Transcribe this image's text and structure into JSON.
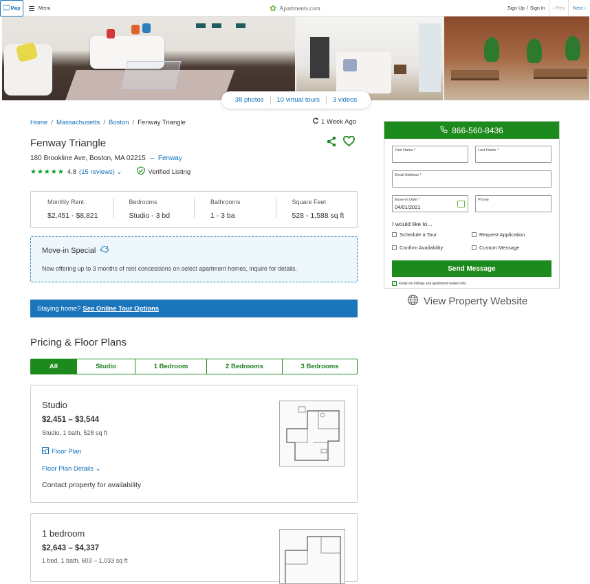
{
  "topbar": {
    "map_label": "Map",
    "menu_label": "Menu",
    "logo_text": "Apartments.com",
    "sign_up": "Sign Up",
    "slash": "/",
    "sign_in": "Sign In",
    "prev": "Prev",
    "next": "Next"
  },
  "gallery": {
    "photos": "38 photos",
    "virtual_tours": "10 virtual tours",
    "videos": "3 videos"
  },
  "breadcrumbs": [
    {
      "label": "Home"
    },
    {
      "label": "Massachusetts"
    },
    {
      "label": "Boston"
    },
    {
      "label": "Fenway Triangle"
    }
  ],
  "breadcrumb_separator": "/",
  "updated": "1 Week Ago",
  "property": {
    "name": "Fenway Triangle",
    "address": "180 Brookline Ave, Boston, MA 02215",
    "neighborhood_sep": "–",
    "neighborhood": "Fenway",
    "stars": "★★★★★",
    "rating": "4.8",
    "reviews": "(15 reviews)",
    "verified": "Verified Listing"
  },
  "facts": [
    {
      "label": "Monthly Rent",
      "value": "$2,451 - $8,821"
    },
    {
      "label": "Bedrooms",
      "value": "Studio - 3 bd"
    },
    {
      "label": "Bathrooms",
      "value": "1 - 3 ba"
    },
    {
      "label": "Square Feet",
      "value": "528 - 1,588 sq ft"
    }
  ],
  "special": {
    "title": "Move-in Special",
    "text": "Now offering up to 3 months of rent concessions on select apartment homes, inquire for details."
  },
  "banner": {
    "text": "Staying home?",
    "link": "See Online Tour Options"
  },
  "pricing": {
    "title": "Pricing & Floor Plans",
    "tabs": [
      "All",
      "Studio",
      "1 Bedroom",
      "2 Bedrooms",
      "3 Bedrooms"
    ]
  },
  "units": [
    {
      "name": "Studio",
      "price": "$2,451 – $3,544",
      "spec": "Studio, 1 bath, 528 sq ft",
      "floor_plan": "Floor Plan",
      "details": "Floor Plan Details",
      "contact": "Contact property for availability"
    },
    {
      "name": "1 bedroom",
      "price": "$2,643 – $4,337",
      "spec": "1 bed, 1 bath, 603 – 1,033 sq ft"
    }
  ],
  "contact_form": {
    "phone": "866-560-8436",
    "first_name": "First Name *",
    "last_name": "Last Name *",
    "email": "Email Address *",
    "move_in_label": "Move-in Date *",
    "move_in_value": "04/01/2021",
    "phone_label": "Phone",
    "like_to": "I would like to...",
    "options": [
      "Schedule a Tour",
      "Request Application",
      "Confirm Availability",
      "Custom Message"
    ],
    "send": "Send Message",
    "email_opt": "Email me listings and apartment related info."
  },
  "website": "View Property Website",
  "colors": {
    "brand_green": "#1d8a1d",
    "link_blue": "#0e6eb8",
    "banner_blue": "#1b75bb",
    "star_green": "#0d9c2b"
  }
}
